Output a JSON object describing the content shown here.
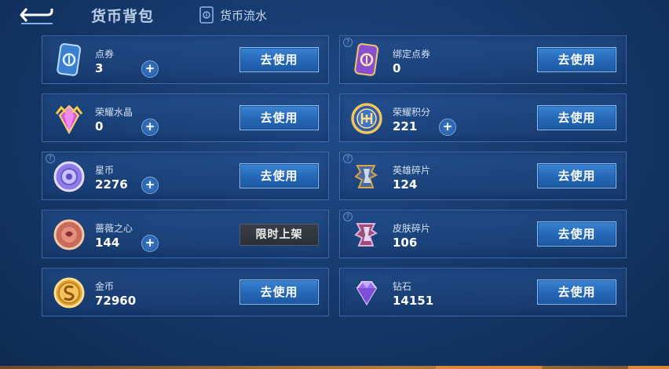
{
  "header": {
    "title": "货币背包",
    "flow_label": "货币流水"
  },
  "colors": {
    "accent": "#2467b6",
    "card_bg": "#1f4e8c",
    "limited_bg": "#2b2f36"
  },
  "cards_left": [
    {
      "name": "点券",
      "amount": "3",
      "icon": "coupon-icon",
      "has_plus": true,
      "button": "去使用",
      "limited": false,
      "help": false
    },
    {
      "name": "荣耀水晶",
      "amount": "0",
      "icon": "crystal-icon",
      "has_plus": true,
      "button": "去使用",
      "limited": false,
      "help": false
    },
    {
      "name": "星币",
      "amount": "2276",
      "icon": "star-coin-icon",
      "has_plus": true,
      "button": "去使用",
      "limited": false,
      "help": true
    },
    {
      "name": "蔷薇之心",
      "amount": "144",
      "icon": "rose-heart-icon",
      "has_plus": true,
      "button": "限时上架",
      "limited": true,
      "help": false
    },
    {
      "name": "金币",
      "amount": "72960",
      "icon": "gold-coin-icon",
      "has_plus": false,
      "button": "去使用",
      "limited": false,
      "help": false
    }
  ],
  "cards_right": [
    {
      "name": "绑定点券",
      "amount": "0",
      "icon": "bound-coupon-icon",
      "has_plus": false,
      "button": "去使用",
      "limited": false,
      "help": true
    },
    {
      "name": "荣耀积分",
      "amount": "221",
      "icon": "honor-points-icon",
      "has_plus": true,
      "button": "去使用",
      "limited": false,
      "help": false
    },
    {
      "name": "英雄碎片",
      "amount": "124",
      "icon": "hero-shard-icon",
      "has_plus": false,
      "button": "去使用",
      "limited": false,
      "help": true
    },
    {
      "name": "皮肤碎片",
      "amount": "106",
      "icon": "skin-shard-icon",
      "has_plus": false,
      "button": "去使用",
      "limited": false,
      "help": true
    },
    {
      "name": "钻石",
      "amount": "14151",
      "icon": "diamond-icon",
      "has_plus": false,
      "button": "去使用",
      "limited": false,
      "help": false
    }
  ]
}
